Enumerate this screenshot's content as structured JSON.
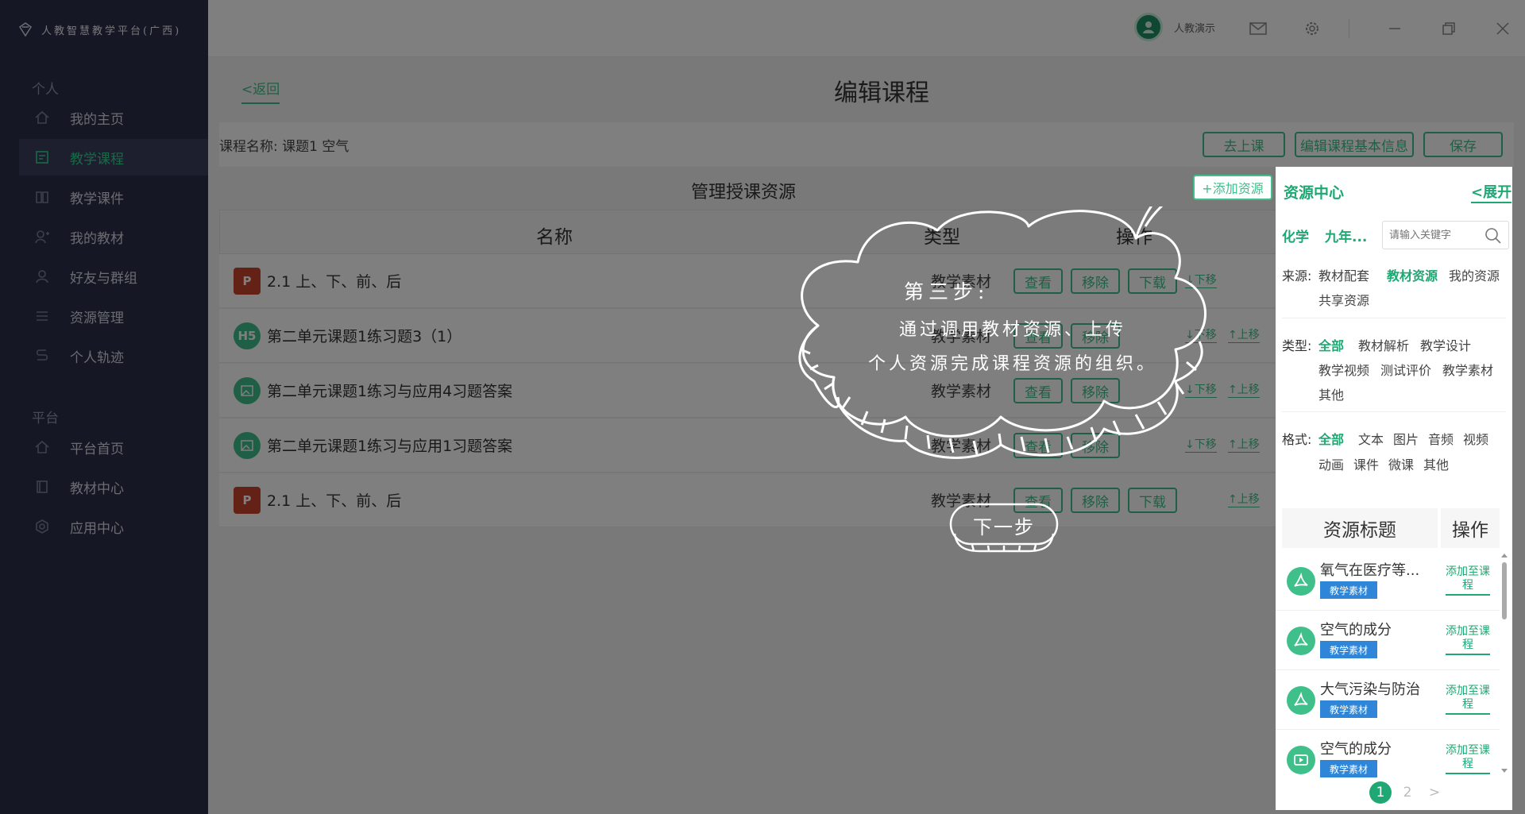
{
  "app": {
    "title": "人教智慧教学平台(广西)"
  },
  "sidebar": {
    "section_personal": "个人",
    "section_platform": "平台",
    "personal_items": [
      {
        "label": "我的主页",
        "icon": "home-icon"
      },
      {
        "label": "教学课程",
        "icon": "course-icon",
        "active": true
      },
      {
        "label": "教学课件",
        "icon": "book-icon"
      },
      {
        "label": "我的教材",
        "icon": "textbook-icon"
      },
      {
        "label": "好友与群组",
        "icon": "contacts-icon"
      },
      {
        "label": "资源管理",
        "icon": "list-icon"
      },
      {
        "label": "个人轨迹",
        "icon": "track-icon"
      }
    ],
    "platform_items": [
      {
        "label": "平台首页",
        "icon": "home-icon"
      },
      {
        "label": "教材中心",
        "icon": "textbook-icon"
      },
      {
        "label": "应用中心",
        "icon": "apps-icon"
      }
    ]
  },
  "topbar": {
    "user_name": "人教演示"
  },
  "main": {
    "back": "<返回",
    "page_title": "编辑课程",
    "course_name": "课程名称: 课题1 空气",
    "buttons": {
      "go_class": "去上课",
      "edit_info": "编辑课程基本信息",
      "save": "保存"
    },
    "manage_title": "管理授课资源",
    "add_resource": "+添加资源",
    "table": {
      "headers": {
        "name": "名称",
        "type": "类型",
        "ops": "操作"
      },
      "actions": {
        "view": "查看",
        "remove": "移除",
        "download": "下载",
        "down": "↓下移",
        "up": "↑上移"
      },
      "rows": [
        {
          "name": "2.1 上、下、前、后",
          "type": "教学素材",
          "icon": "ppt",
          "badge": "P"
        },
        {
          "name": "第二单元课题1练习题3（1）",
          "type": "教学素材",
          "icon": "h5",
          "badge": "H5"
        },
        {
          "name": "第二单元课题1练习与应用4习题答案",
          "type": "教学素材",
          "icon": "img",
          "badge": ""
        },
        {
          "name": "第二单元课题1练习与应用1习题答案",
          "type": "教学素材",
          "icon": "img",
          "badge": ""
        },
        {
          "name": "2.1 上、下、前、后",
          "type": "教学素材",
          "icon": "ppt",
          "badge": "P"
        }
      ]
    }
  },
  "resource_center": {
    "title": "资源中心",
    "expand": "<展开",
    "subject": "化学",
    "grade": "九年...",
    "search_placeholder": "请输入关键字",
    "source_label": "来源:",
    "source_options": [
      "教材配套",
      "教材资源",
      "我的资源",
      "共享资源"
    ],
    "type_label": "类型:",
    "type_options": [
      "全部",
      "教材解析",
      "教学设计",
      "教学视频",
      "测试评价",
      "教学素材",
      "其他"
    ],
    "format_label": "格式:",
    "format_options": [
      "全部",
      "文本",
      "图片",
      "音频",
      "视频",
      "动画",
      "课件",
      "微课",
      "其他"
    ],
    "col_title": "资源标题",
    "col_ops": "操作",
    "add_to_course": "添加至课程",
    "items": [
      {
        "title": "氧气在医疗等...",
        "badge": "教学素材",
        "icon": "pdf-icon"
      },
      {
        "title": "空气的成分",
        "badge": "教学素材",
        "icon": "pdf-icon"
      },
      {
        "title": "大气污染与防治",
        "badge": "教学素材",
        "icon": "pdf-icon"
      },
      {
        "title": "空气的成分",
        "badge": "教学素材",
        "icon": "video-icon"
      }
    ],
    "pages": [
      "1",
      "2"
    ],
    "current_page": "1",
    "next_page": ">"
  },
  "guide": {
    "step_title": "第三步:",
    "step_line1": "通过调用教材资源、上传",
    "step_line2": "个人资源完成课程资源的组织。",
    "next": "下一步"
  },
  "colors": {
    "accent": "#1fa873",
    "sidebar_bg": "#2b2e48",
    "badge_blue": "#2f86d8",
    "ppt_red": "#c9452d"
  }
}
